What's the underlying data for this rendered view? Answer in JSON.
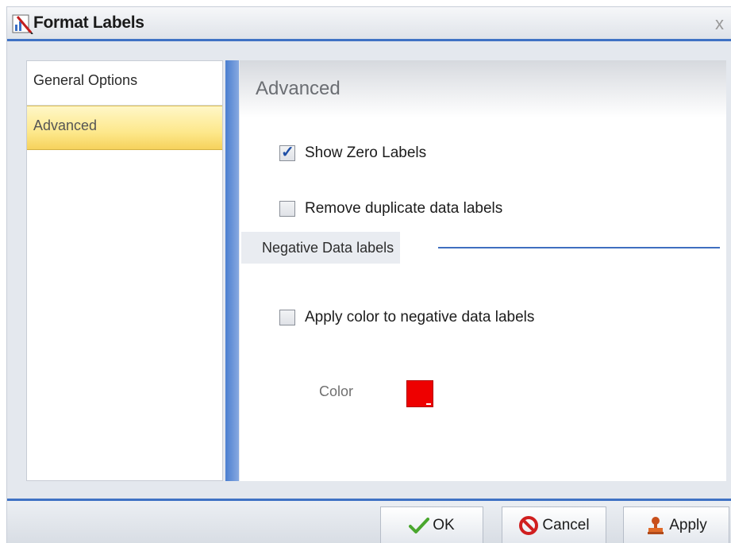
{
  "window": {
    "title": "Format Labels",
    "close_glyph": "x",
    "title_icon": "format-labels-icon"
  },
  "nav": {
    "items": [
      {
        "label": "General Options",
        "selected": false
      },
      {
        "label": "Advanced",
        "selected": true
      }
    ]
  },
  "panel": {
    "title": "Advanced",
    "show_zero_labels": {
      "label": "Show Zero Labels",
      "checked": true
    },
    "remove_duplicate": {
      "label": "Remove duplicate data labels",
      "checked": false
    },
    "negative_group": {
      "label": "Negative Data labels"
    },
    "apply_color": {
      "label": "Apply color to negative data labels",
      "checked": false
    },
    "color": {
      "label": "Color",
      "value": "#ee0000"
    }
  },
  "footer": {
    "ok": {
      "label": "OK",
      "icon": "check-icon"
    },
    "cancel": {
      "label": "Cancel",
      "icon": "cancel-icon"
    },
    "apply": {
      "label": "Apply",
      "icon": "apply-stamp-icon"
    }
  },
  "colors": {
    "accent_blue": "#3f72c4",
    "selected_item": "#fde88c"
  }
}
